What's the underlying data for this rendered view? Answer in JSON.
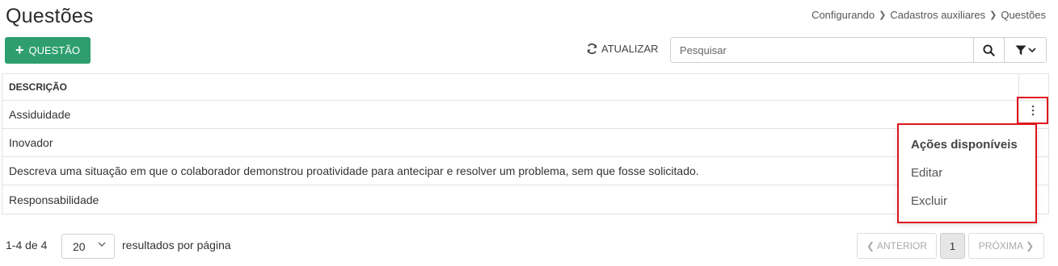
{
  "page": {
    "title": "Questões",
    "breadcrumb": [
      "Configurando",
      "Cadastros auxiliares",
      "Questões"
    ]
  },
  "toolbar": {
    "add_label": "QUESTÃO",
    "refresh_label": "ATUALIZAR",
    "search_placeholder": "Pesquisar"
  },
  "table": {
    "header": "DESCRIÇÃO",
    "rows": [
      "Assiduidade",
      "Inovador",
      "Descreva uma situação em que o colaborador demonstrou proatividade para antecipar e resolver um problema, sem que fosse solicitado.",
      "Responsabilidade"
    ]
  },
  "actions_menu": {
    "title": "Ações disponíveis",
    "items": [
      "Editar",
      "Excluir"
    ]
  },
  "footer": {
    "results": "1-4 de 4",
    "per_page_value": "20",
    "per_page_label": "resultados por página",
    "prev_label": "ANTERIOR",
    "current_page": "1",
    "next_label": "PRÓXIMA"
  },
  "colors": {
    "primary": "#2e9e6e",
    "highlight": "#e0141e"
  }
}
